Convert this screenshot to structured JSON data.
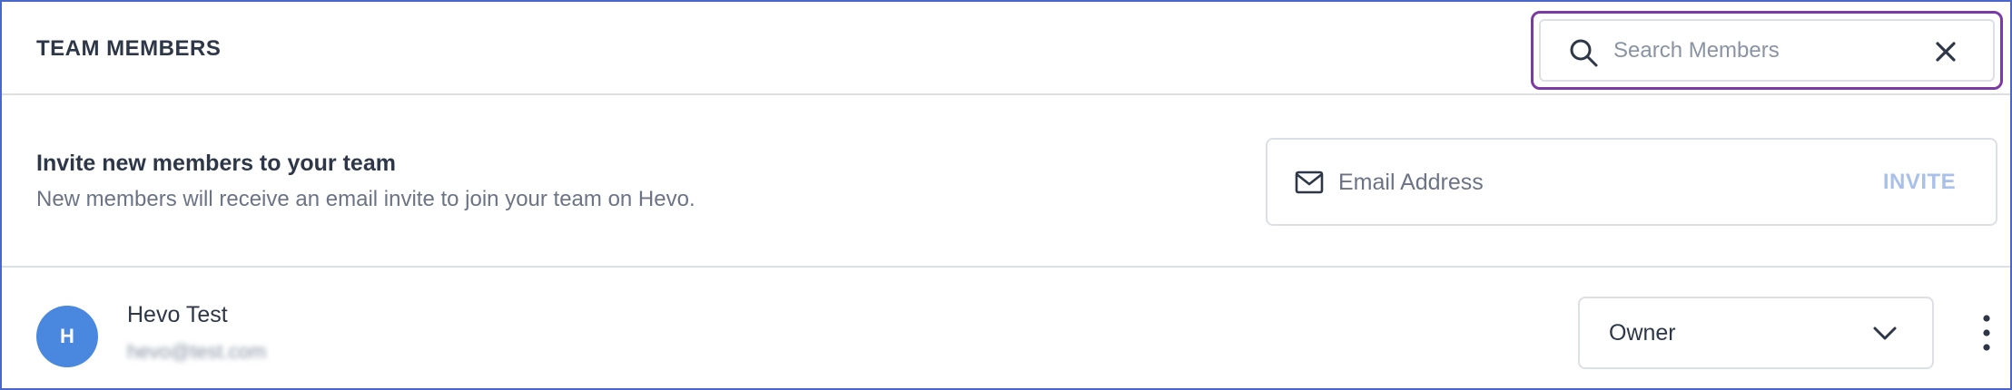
{
  "header": {
    "title": "TEAM MEMBERS",
    "search": {
      "placeholder": "Search Members",
      "value": ""
    }
  },
  "invite": {
    "heading": "Invite new members to your team",
    "subtext": "New members will receive an email invite to join your team on Hevo.",
    "email_placeholder": "Email Address",
    "button_label": "INVITE"
  },
  "members": [
    {
      "initial": "H",
      "name": "Hevo Test",
      "email": "hevo@test.com",
      "role": "Owner"
    }
  ],
  "colors": {
    "accent_focus": "#7b3aa6",
    "avatar_bg": "#4a88e0",
    "invite_disabled": "#a8c0ea",
    "frame_border": "#4a67c8"
  },
  "icons": {
    "search": "search-icon",
    "clear": "close-icon",
    "mail": "mail-icon",
    "chevron": "chevron-down-icon",
    "more": "more-vertical-icon"
  }
}
